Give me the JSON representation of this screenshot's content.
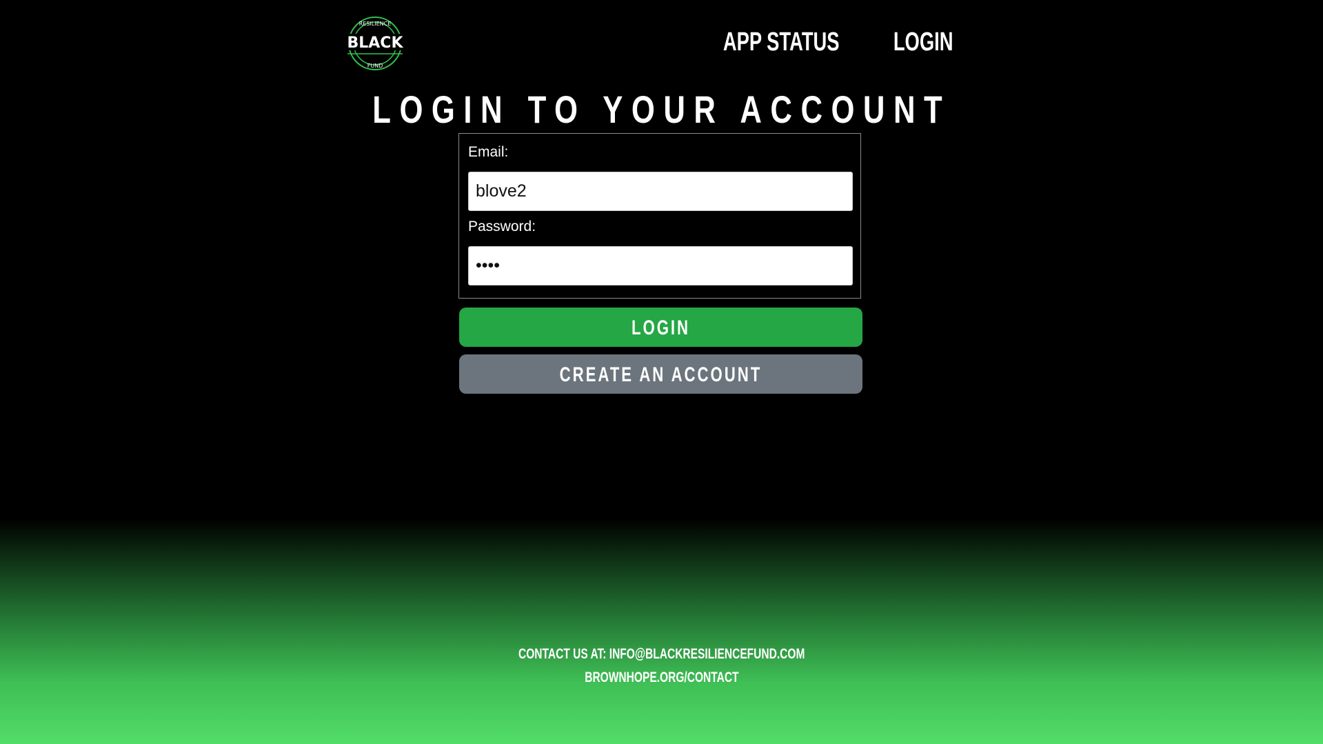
{
  "brand": {
    "logo_top": "RESILIENCE",
    "logo_main": "BLACK",
    "logo_bottom": "FUND",
    "accent_color": "#2fc24d"
  },
  "nav": {
    "items": [
      {
        "label": "APP STATUS"
      },
      {
        "label": "LOGIN"
      }
    ]
  },
  "page": {
    "title": "LOGIN TO YOUR ACCOUNT"
  },
  "form": {
    "email_label": "Email:",
    "email_value": "blove2",
    "password_label": "Password:",
    "password_value": "••••"
  },
  "buttons": {
    "login_label": "LOGIN",
    "login_color": "#25a745",
    "create_label": "CREATE AN ACCOUNT",
    "create_color": "#6c757d"
  },
  "footer": {
    "contact": "CONTACT US AT: INFO@BLACKRESILIENCEFUND.COM",
    "link": "BROWNHOPE.ORG/CONTACT"
  }
}
